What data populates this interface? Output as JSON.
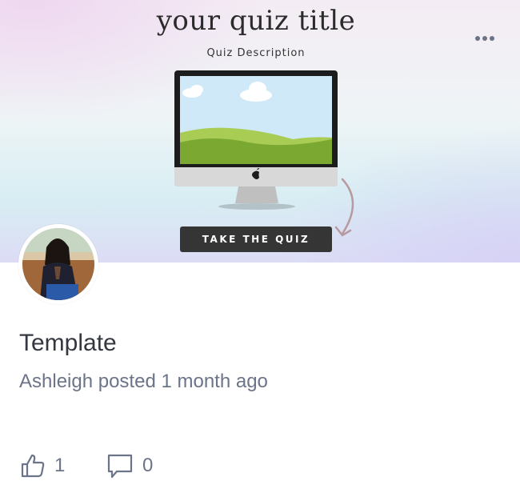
{
  "hero": {
    "title": "your quiz title",
    "description": "Quiz Description",
    "cta_label": "TAKE THE QUIZ"
  },
  "post": {
    "title": "Template",
    "meta": "Ashleigh posted 1 month ago"
  },
  "actions": {
    "like_count": "1",
    "comment_count": "0"
  },
  "icons": [
    "more-icon",
    "like-icon",
    "comment-icon",
    "apple-logo-icon"
  ],
  "colors": {
    "muted_text": "#6b7488",
    "title_text": "#333840",
    "cta_bg": "#353535"
  }
}
